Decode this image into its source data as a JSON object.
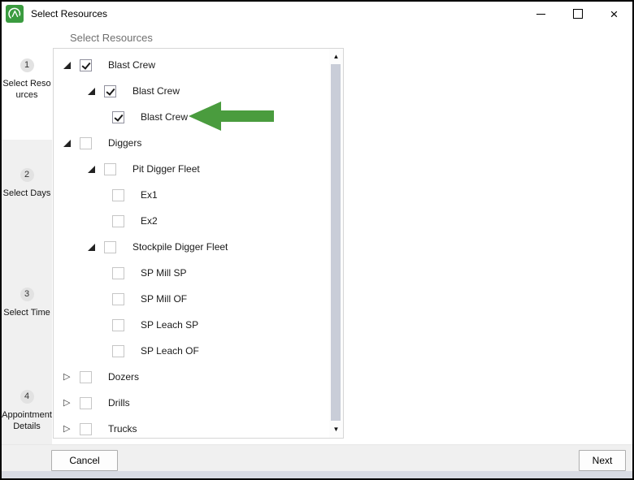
{
  "window": {
    "title": "Select Resources"
  },
  "icons": {
    "close": "×",
    "scroll_up": "▲",
    "scroll_down": "▼"
  },
  "colors": {
    "logo_green": "#3a9b3f",
    "annotation_green": "#4a9c3e"
  },
  "steps": [
    {
      "num": "1",
      "label": "Select Resources",
      "active": true
    },
    {
      "num": "2",
      "label": "Select Days",
      "active": false
    },
    {
      "num": "3",
      "label": "Select Time",
      "active": false
    },
    {
      "num": "4",
      "label": "Appointment Details",
      "active": false
    }
  ],
  "content": {
    "heading": "Select Resources"
  },
  "tree": {
    "annotation": {
      "shape": "left-arrow",
      "color": "#4a9c3e",
      "points_at": "Blast Crew"
    },
    "items": [
      {
        "label": "Blast Crew",
        "level": 1,
        "arrow": "expanded",
        "state": "checked"
      },
      {
        "label": "Blast Crew",
        "level": 2,
        "arrow": "expanded",
        "state": "checked"
      },
      {
        "label": "Blast Crew",
        "level": 3,
        "arrow": "none",
        "state": "checked"
      },
      {
        "label": "Diggers",
        "level": 1,
        "arrow": "expanded",
        "state": "unchecked"
      },
      {
        "label": "Pit Digger Fleet",
        "level": 2,
        "arrow": "expanded",
        "state": "unchecked"
      },
      {
        "label": "Ex1",
        "level": 3,
        "arrow": "none",
        "state": "unchecked"
      },
      {
        "label": "Ex2",
        "level": 3,
        "arrow": "none",
        "state": "unchecked"
      },
      {
        "label": "Stockpile Digger Fleet",
        "level": 2,
        "arrow": "expanded",
        "state": "unchecked"
      },
      {
        "label": "SP Mill SP",
        "level": 3,
        "arrow": "none",
        "state": "unchecked"
      },
      {
        "label": "SP Mill OF",
        "level": 3,
        "arrow": "none",
        "state": "unchecked"
      },
      {
        "label": "SP Leach SP",
        "level": 3,
        "arrow": "none",
        "state": "unchecked"
      },
      {
        "label": "SP Leach OF",
        "level": 3,
        "arrow": "none",
        "state": "unchecked"
      },
      {
        "label": "Dozers",
        "level": 1,
        "arrow": "collapsed",
        "state": "unchecked"
      },
      {
        "label": "Drills",
        "level": 1,
        "arrow": "collapsed",
        "state": "unchecked"
      },
      {
        "label": "Trucks",
        "level": 1,
        "arrow": "collapsed",
        "state": "unchecked"
      }
    ]
  },
  "footer": {
    "cancel_label": "Cancel",
    "next_label": "Next"
  }
}
